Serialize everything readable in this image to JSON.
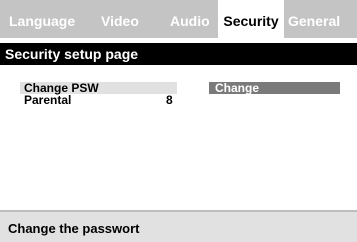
{
  "tabs": [
    {
      "label": "Language"
    },
    {
      "label": "Video"
    },
    {
      "label": "Audio"
    },
    {
      "label": "Security"
    },
    {
      "label": "General"
    }
  ],
  "active_tab": "Security",
  "page_title": "Security setup page",
  "settings": [
    {
      "label": "Change PSW",
      "value": ""
    },
    {
      "label": "Parental",
      "value": "8"
    }
  ],
  "option": {
    "label": "Change"
  },
  "status": {
    "text": "Change the passwort"
  },
  "colors": {
    "tab_bar": "#c4c4c4",
    "title_bar": "#000000",
    "highlight": "#e1e1e1",
    "option_bg": "#7a7a7a",
    "status_bar": "#e1e1e1"
  }
}
